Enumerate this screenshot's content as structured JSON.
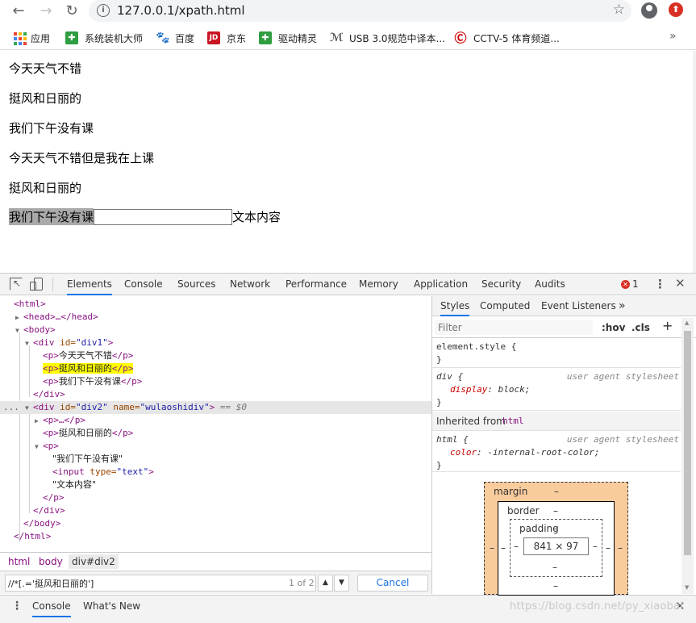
{
  "browser": {
    "url": "127.0.0.1/xpath.html",
    "bookmarks": [
      {
        "label": "应用",
        "icon": "apps-icon"
      },
      {
        "label": "系统装机大师",
        "icon": "green-square-icon"
      },
      {
        "label": "百度",
        "icon": "baidu-paw-icon"
      },
      {
        "label": "京东",
        "icon": "jd-icon"
      },
      {
        "label": "驱动精灵",
        "icon": "green-square-icon"
      },
      {
        "label": "USB 3.0规范中译本...",
        "icon": "usb-icon"
      },
      {
        "label": "CCTV-5 体育频道...",
        "icon": "cctv-icon"
      }
    ],
    "jd_glyph": "JD"
  },
  "page": {
    "paragraphs": [
      "今天天气不错",
      "挺风和日丽的",
      "我们下午没有课",
      "今天天气不错但是我在上课",
      "挺风和日丽的"
    ],
    "last_para": {
      "highlighted": "我们下午没有课",
      "after": "文本内容"
    }
  },
  "devtools": {
    "tabs": [
      "Elements",
      "Console",
      "Sources",
      "Network",
      "Performance",
      "Memory",
      "Application",
      "Security",
      "Audits"
    ],
    "error_count": "1",
    "tree": {
      "html_open": "<html>",
      "head": "<head>…</head>",
      "body_open": "<body>",
      "div1_tag": "<div ",
      "div1_attr": "id=",
      "div1_val": "\"div1\"",
      "div1_close": ">",
      "p_open": "<p>",
      "p_close": "</p>",
      "p1": "今天天气不错",
      "p2": "挺风和日丽的",
      "p3": "我们下午没有课",
      "div_close": "</div>",
      "div2_attr1": "id=",
      "div2_val1": "\"div2\"",
      "div2_attr2": "name=",
      "div2_val2": "\"wulaoshidiv\"",
      "div2_marker": "== $0",
      "p_collapsed": "<p>…</p>",
      "p5": "挺风和日丽的",
      "text1": "\"我们下午没有课\"",
      "input_tag": "<input ",
      "input_attr": "type=",
      "input_val": "\"text\"",
      "text2": "\"文本内容\"",
      "body_close": "</body>",
      "html_close": "</html>",
      "ellipsis": "..."
    },
    "breadcrumbs": [
      "html",
      "body",
      "div#div2"
    ],
    "search": {
      "value": "//*[.='挺风和日丽的']",
      "count": "1 of 2",
      "cancel": "Cancel"
    },
    "styles_tabs": [
      "Styles",
      "Computed",
      "Event Listeners"
    ],
    "filter_placeholder": "Filter",
    "hov": ":hov",
    "cls": ".cls",
    "rules": {
      "element_style": "element.style {",
      "close": "}",
      "div_selector": "div {",
      "ua_label": "user agent stylesheet",
      "div_prop": "display",
      "div_val": "block;",
      "inherited_label": "Inherited from",
      "inherited_tag": "html",
      "html_selector": "html {",
      "html_prop": "color",
      "html_val": "-internal-root-color;"
    },
    "box_model": {
      "margin": "margin",
      "border": "border",
      "padding": "padding",
      "content": "841 × 97",
      "dash": "–"
    },
    "drawer_tabs": [
      "Console",
      "What's New"
    ],
    "watermark": "https://blog.csdn.net/py_xiaobai"
  }
}
